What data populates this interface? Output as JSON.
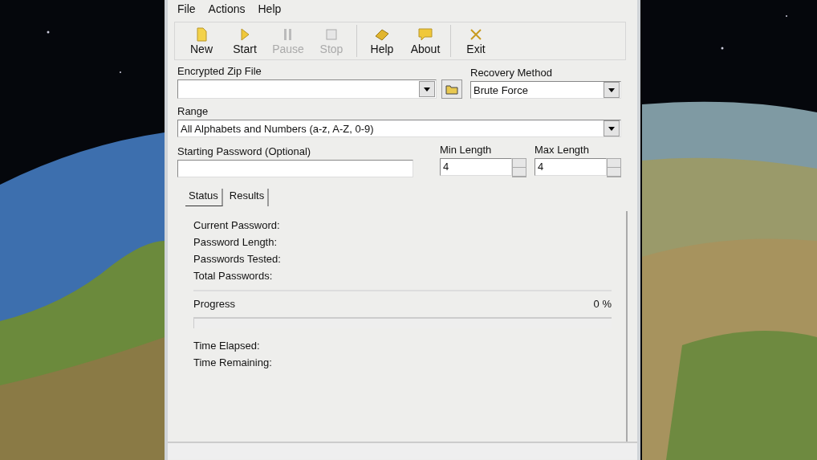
{
  "menu": [
    "File",
    "Actions",
    "Help"
  ],
  "toolbar": [
    {
      "label": "New",
      "kind": "new",
      "disabled": false
    },
    {
      "label": "Start",
      "kind": "start",
      "disabled": false
    },
    {
      "label": "Pause",
      "kind": "pause",
      "disabled": true
    },
    {
      "label": "Stop",
      "kind": "stop",
      "disabled": true
    },
    {
      "kind": "separator"
    },
    {
      "label": "Help",
      "kind": "help",
      "disabled": false
    },
    {
      "label": "About",
      "kind": "about",
      "disabled": false
    },
    {
      "kind": "separator"
    },
    {
      "label": "Exit",
      "kind": "exit",
      "disabled": false
    }
  ],
  "zip_file": {
    "label": "Encrypted Zip File"
  },
  "recovery_method": {
    "label": "Recovery Method",
    "value": "Brute Force"
  },
  "range": {
    "label": "Range",
    "value": "All Alphabets and Numbers (a-z, A-Z, 0-9)"
  },
  "starting_password": {
    "label": "Starting Password (Optional)"
  },
  "min_length": {
    "label": "Min Length",
    "value": "4"
  },
  "max_length": {
    "label": "Max Length",
    "value": "4"
  },
  "tabs": [
    {
      "label": "Status",
      "selected": true
    },
    {
      "label": "Results",
      "selected": false
    }
  ],
  "status_fields": [
    "Current Password:",
    "Password Length:",
    "Passwords Tested:",
    "Total Passwords:"
  ],
  "progress": {
    "label": "Progress",
    "reading": "0 %",
    "level": 0
  },
  "time_fields": [
    "Time Elapsed:",
    "Time Remaining:"
  ]
}
